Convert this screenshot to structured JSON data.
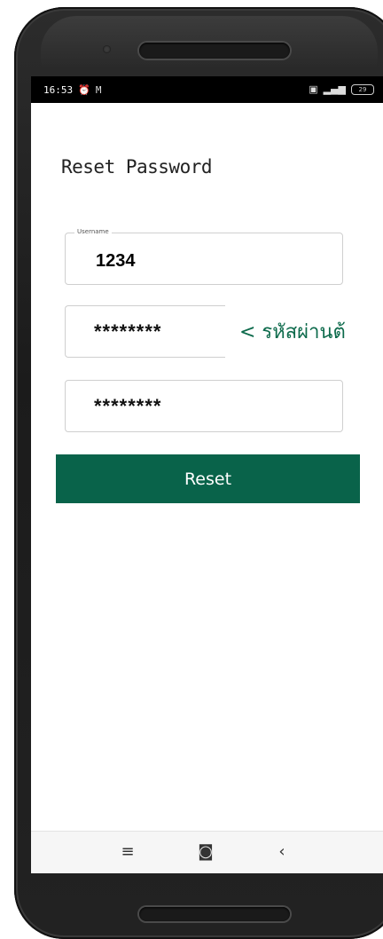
{
  "status_bar": {
    "time": "16:53",
    "alarm_icon": "alarm-icon",
    "gmail_icon": "gmail-icon",
    "battery": "29"
  },
  "page": {
    "title": "Reset Password"
  },
  "form": {
    "username_label": "Username",
    "username_value": "1234",
    "new_password_value": "********",
    "confirm_password_value": "********",
    "hint_text": "< รหัสผ่านต้",
    "reset_label": "Reset"
  },
  "nav": {
    "menu_icon": "≡",
    "home_icon": "◙",
    "back_icon": "‹"
  },
  "colors": {
    "accent": "#09634a",
    "hint": "#0c6a4b"
  }
}
